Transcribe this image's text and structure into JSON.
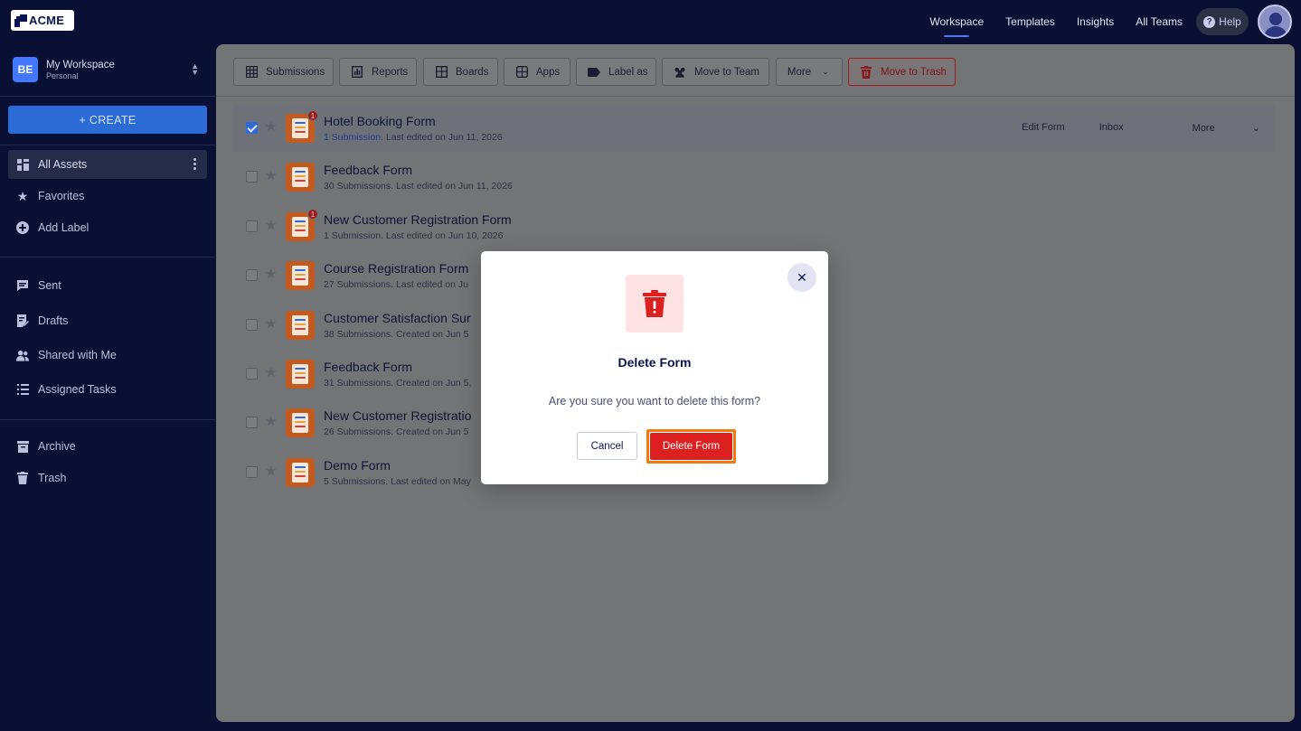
{
  "brand": {
    "logo_text": "ACME"
  },
  "topnav": {
    "items": [
      "Workspace",
      "Templates",
      "Insights",
      "All Teams"
    ],
    "help": "Help",
    "help_glyph": "?"
  },
  "sidebar": {
    "workspace_badge": "BE",
    "workspace_name": "My Workspace",
    "workspace_sub": "Personal",
    "create_label": "+ CREATE",
    "items": [
      {
        "label": "All Assets",
        "icon": "grid-icon"
      },
      {
        "label": "Favorites",
        "icon": "star-icon"
      },
      {
        "label": "Add Label",
        "icon": "plus-circle-icon"
      },
      {
        "label": "Sent",
        "icon": "message-icon"
      },
      {
        "label": "Drafts",
        "icon": "draft-icon"
      },
      {
        "label": "Shared with Me",
        "icon": "users-icon"
      },
      {
        "label": "Assigned Tasks",
        "icon": "tasks-icon"
      },
      {
        "label": "Archive",
        "icon": "archive-icon"
      },
      {
        "label": "Trash",
        "icon": "trash-icon"
      }
    ]
  },
  "toolbar": {
    "submissions": "Submissions",
    "reports": "Reports",
    "boards": "Boards",
    "apps": "Apps",
    "label_as": "Label as",
    "move_to_team": "Move to Team",
    "more": "More",
    "move_to_trash": "Move to Trash"
  },
  "forms": [
    {
      "title": "Hotel Booking Form",
      "submissions": "1 Submission",
      "meta": ". Last edited on Jun 11, 2026",
      "badge": "1",
      "selected": true
    },
    {
      "title": "Feedback Form",
      "submissions": "30 Submissions",
      "meta": ". Last edited on Jun 11, 2026",
      "badge": "",
      "selected": false
    },
    {
      "title": "New Customer Registration Form",
      "submissions": "1 Submission",
      "meta": ". Last edited on Jun 10, 2026",
      "badge": "1",
      "selected": false
    },
    {
      "title": "Course Registration Form",
      "submissions": "27 Submissions",
      "meta": ". Last edited on Ju",
      "badge": "",
      "selected": false
    },
    {
      "title": "Customer Satisfaction Sur",
      "submissions": "38 Submissions",
      "meta": ". Created on Jun 5",
      "badge": "",
      "selected": false
    },
    {
      "title": "Feedback Form",
      "submissions": "31 Submissions",
      "meta": ". Created on Jun 5,",
      "badge": "",
      "selected": false
    },
    {
      "title": "New Customer Registratio",
      "submissions": "26 Submissions",
      "meta": ". Created on Jun 5",
      "badge": "",
      "selected": false
    },
    {
      "title": "Demo Form",
      "submissions": "5 Submissions",
      "meta": ". Last edited on May",
      "badge": "",
      "selected": false
    }
  ],
  "row_actions": {
    "edit": "Edit Form",
    "inbox": "Inbox",
    "more": "More"
  },
  "modal": {
    "title": "Delete Form",
    "message": "Are you sure you want to delete this form?",
    "cancel": "Cancel",
    "confirm": "Delete Form",
    "close_glyph": "✕"
  },
  "colors": {
    "background": "#0a1033",
    "accent": "#4277ff",
    "danger": "#dc1f1f",
    "highlight": "#f07a10"
  }
}
